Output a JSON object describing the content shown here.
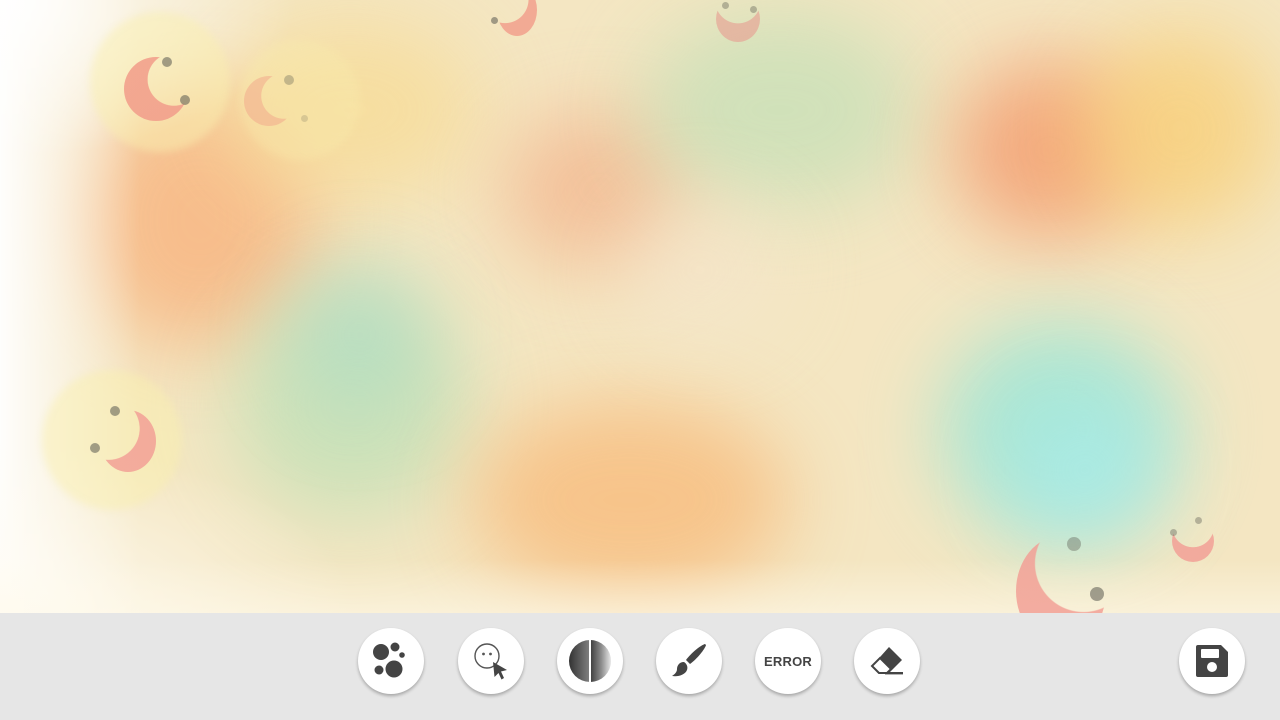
{
  "toolbar": {
    "tools": [
      {
        "icon": "bubbles-icon",
        "status_text": ""
      },
      {
        "icon": "face-cursor-icon",
        "status_text": ""
      },
      {
        "icon": "gradient-circle-icon",
        "status_text": ""
      },
      {
        "icon": "brush-icon",
        "status_text": ""
      },
      {
        "icon": "",
        "status_text": "ERROR"
      },
      {
        "icon": "eraser-icon",
        "status_text": ""
      }
    ],
    "save": {
      "icon": "floppy-disk-icon"
    }
  },
  "colors": {
    "toolbar_bg": "#e6e6e6",
    "button_bg": "#ffffff",
    "icon_color": "#444444",
    "moon_color": "#f2a99a"
  }
}
